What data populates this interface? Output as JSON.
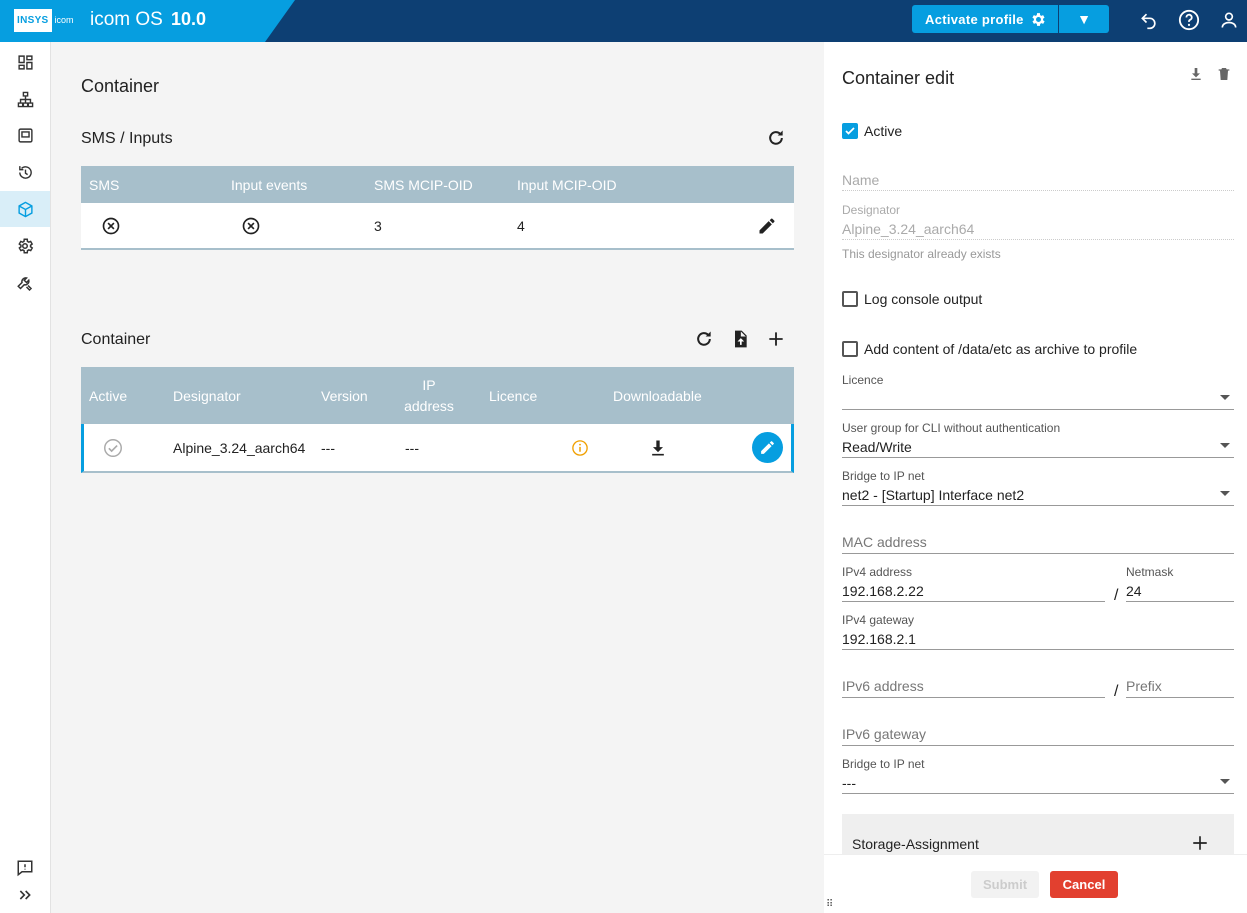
{
  "header": {
    "logo_left": "INSYS",
    "logo_right": "icom",
    "os_name": "icom OS",
    "version": "10.0",
    "activate_label": "Activate profile"
  },
  "sidenav": {
    "items": [
      "dashboard-icon",
      "network-icon",
      "device-icon",
      "history-icon",
      "container-icon",
      "settings-icon",
      "tools-icon"
    ],
    "bottom": [
      "feedback-icon",
      "expand-icon"
    ]
  },
  "main": {
    "page_title": "Container",
    "sms": {
      "title": "SMS / Inputs",
      "headers": [
        "SMS",
        "Input events",
        "SMS MCIP-OID",
        "Input MCIP-OID"
      ],
      "row": {
        "sms_mcip": "3",
        "input_mcip": "4"
      }
    },
    "container": {
      "title": "Container",
      "headers": [
        "Active",
        "Designator",
        "Version",
        "IP address",
        "Licence",
        "Downloadable"
      ],
      "row": {
        "designator": "Alpine_3.24_aarch64",
        "version": "---",
        "ip": "---"
      }
    }
  },
  "panel": {
    "title": "Container edit",
    "active_label": "Active",
    "name_placeholder": "Name",
    "designator_label": "Designator",
    "designator_value": "Alpine_3.24_aarch64",
    "designator_hint": "This designator already exists",
    "log_console_label": "Log console output",
    "add_content_label": "Add content of /data/etc as archive to profile",
    "licence_label": "Licence",
    "user_group_label": "User group for CLI without authentication",
    "user_group_value": "Read/Write",
    "bridge_label": "Bridge to IP net",
    "bridge_value": "net2 - [Startup] Interface net2",
    "mac_placeholder": "MAC address",
    "ipv4_label": "IPv4 address",
    "ipv4_value": "192.168.2.22",
    "netmask_label": "Netmask",
    "netmask_value": "24",
    "ipv4_gw_label": "IPv4 gateway",
    "ipv4_gw_value": "192.168.2.1",
    "ipv6_placeholder": "IPv6 address",
    "prefix_placeholder": "Prefix",
    "ipv6_gw_placeholder": "IPv6 gateway",
    "bridge2_label": "Bridge to IP net",
    "bridge2_value": "---",
    "storage_label": "Storage-Assignment",
    "submit_label": "Submit",
    "cancel_label": "Cancel",
    "slash": "/"
  }
}
